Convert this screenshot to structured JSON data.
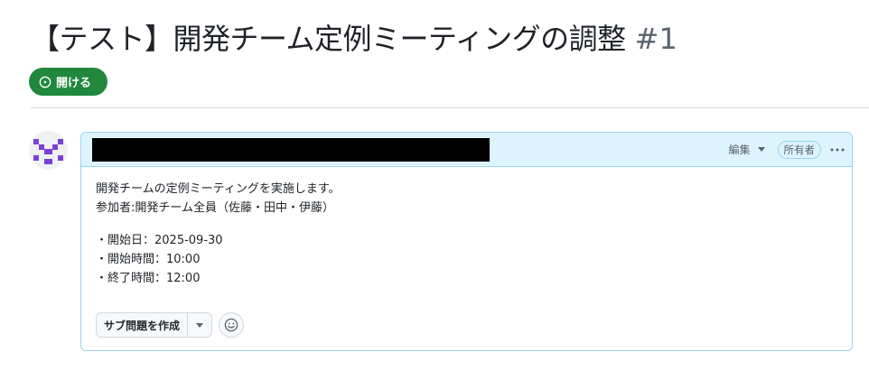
{
  "issue": {
    "title": "【テスト】開発チーム定例ミーティングの調整",
    "number": "#1",
    "state_label": "開ける"
  },
  "comment": {
    "edit_label": "編集",
    "owner_badge": "所有者",
    "body_lines": [
      "開発チームの定例ミーティングを実施します。",
      "参加者:開発チーム全員（佐藤・田中・伊藤）",
      "",
      "・開始日：2025-09-30",
      "・開始時間：10:00",
      "・終了時間：12:00"
    ],
    "create_subissue_label": "サブ問題を作成"
  },
  "colors": {
    "open_state": "#1f883d",
    "header_bg": "#ddf4ff",
    "header_border": "#9cd2ef",
    "avatar_accent": "#7c3fd6"
  },
  "icons": {
    "state": "issue-opened-icon",
    "avatar": "identicon",
    "edit_menu": "triangle-down-icon",
    "more": "kebab-horizontal-icon",
    "subissue_menu": "triangle-down-icon",
    "reaction": "smiley-icon"
  }
}
